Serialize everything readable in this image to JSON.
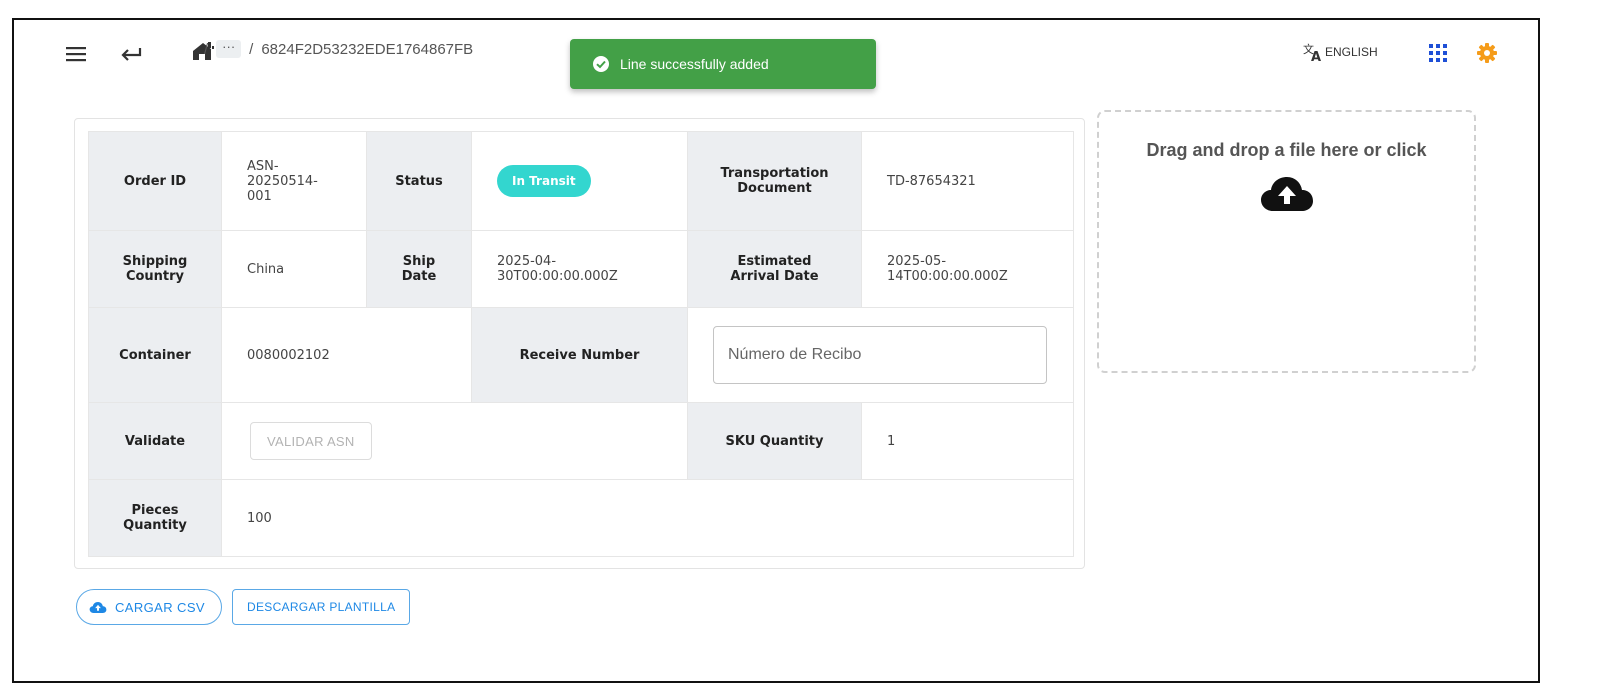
{
  "breadcrumb": {
    "separator": "/",
    "ellipsis": "···",
    "current": "6824F2D53232EDE1764867FB"
  },
  "toast": {
    "message": "Line successfully added",
    "color": "#43a047"
  },
  "language": {
    "label": "ENGLISH"
  },
  "order": {
    "order_id_label": "Order ID",
    "order_id_value": "ASN-20250514-001",
    "status_label": "Status",
    "status_value": "In Transit",
    "transport_doc_label": "Transportation Document",
    "transport_doc_value": "TD-87654321",
    "shipping_country_label": "Shipping Country",
    "shipping_country_value": "China",
    "ship_date_label": "Ship Date",
    "ship_date_value": "2025-04-30T00:00:00.000Z",
    "eta_label": "Estimated Arrival Date",
    "eta_value": "2025-05-14T00:00:00.000Z",
    "container_label": "Container",
    "container_value": "0080002102",
    "receive_number_label": "Receive Number",
    "receive_number_placeholder": "Número de Recibo",
    "validate_label": "Validate",
    "validate_button": "VALIDAR ASN",
    "sku_quantity_label": "SKU Quantity",
    "sku_quantity_value": "1",
    "pieces_quantity_label": "Pieces Quantity",
    "pieces_quantity_value": "100"
  },
  "dropzone": {
    "text": "Drag and drop a file here or click"
  },
  "actions": {
    "upload_csv": "CARGAR CSV",
    "download_template": "DESCARGAR PLANTILLA"
  },
  "colors": {
    "status_badge": "#33d6cf",
    "accent": "#1e88e5",
    "settings": "#f59c1a"
  }
}
